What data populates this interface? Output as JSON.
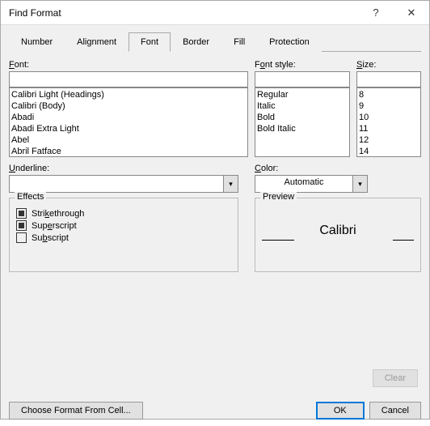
{
  "title": "Find Format",
  "tabs": [
    "Number",
    "Alignment",
    "Font",
    "Border",
    "Fill",
    "Protection"
  ],
  "activeTab": 2,
  "labels": {
    "font": "Font:",
    "fontStyle": "Font style:",
    "size": "Size:",
    "underline": "Underline:",
    "color": "Color:",
    "effects": "Effects",
    "preview": "Preview",
    "strikethrough": "Strikethrough",
    "superscript": "Superscript",
    "subscript": "Subscript"
  },
  "fontList": [
    "Calibri Light (Headings)",
    "Calibri (Body)",
    "Abadi",
    "Abadi Extra Light",
    "Abel",
    "Abril Fatface"
  ],
  "styleList": [
    "Regular",
    "Italic",
    "Bold",
    "Bold Italic"
  ],
  "sizeList": [
    "8",
    "9",
    "10",
    "11",
    "12",
    "14"
  ],
  "colorValue": "Automatic",
  "previewFont": "Calibri",
  "buttons": {
    "clear": "Clear",
    "choose": "Choose Format From Cell...",
    "ok": "OK",
    "cancel": "Cancel"
  }
}
